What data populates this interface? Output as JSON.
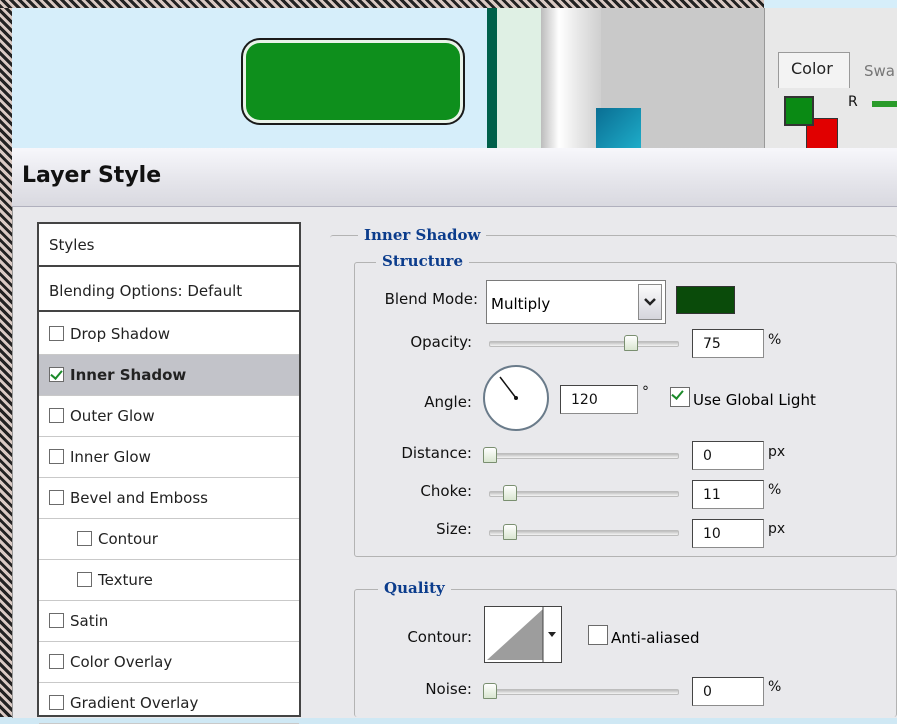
{
  "color_panel": {
    "tab_color": "Color",
    "tab_swatches": "Swa",
    "channel_r": "R"
  },
  "dialog": {
    "title": "Layer Style"
  },
  "styles_list": {
    "header": "Styles",
    "blending": "Blending Options: Default",
    "items": [
      {
        "label": "Drop Shadow",
        "checked": false
      },
      {
        "label": "Inner Shadow",
        "checked": true
      },
      {
        "label": "Outer Glow",
        "checked": false
      },
      {
        "label": "Inner Glow",
        "checked": false
      },
      {
        "label": "Bevel and Emboss",
        "checked": false
      },
      {
        "label": "Contour",
        "checked": false
      },
      {
        "label": "Texture",
        "checked": false
      },
      {
        "label": "Satin",
        "checked": false
      },
      {
        "label": "Color Overlay",
        "checked": false
      },
      {
        "label": "Gradient Overlay",
        "checked": false
      }
    ]
  },
  "inner_shadow": {
    "section_title": "Inner Shadow",
    "structure_title": "Structure",
    "blend_mode_label": "Blend Mode:",
    "blend_mode_value": "Multiply",
    "shadow_color": "#0a4b0a",
    "opacity_label": "Opacity:",
    "opacity_value": "75",
    "opacity_unit": "%",
    "angle_label": "Angle:",
    "angle_value": "120",
    "angle_unit": "°",
    "use_global_light_label": "Use Global Light",
    "use_global_light": true,
    "distance_label": "Distance:",
    "distance_value": "0",
    "distance_unit": "px",
    "choke_label": "Choke:",
    "choke_value": "11",
    "choke_unit": "%",
    "size_label": "Size:",
    "size_value": "10",
    "size_unit": "px"
  },
  "quality": {
    "title": "Quality",
    "contour_label": "Contour:",
    "anti_aliased_label": "Anti-aliased",
    "anti_aliased": false,
    "noise_label": "Noise:",
    "noise_value": "0",
    "noise_unit": "%"
  },
  "colors": {
    "canvas_shape": "#0e8f1c",
    "foreground": "#0a8a14",
    "background": "#e10000",
    "accent_title": "#0b3c8c"
  }
}
